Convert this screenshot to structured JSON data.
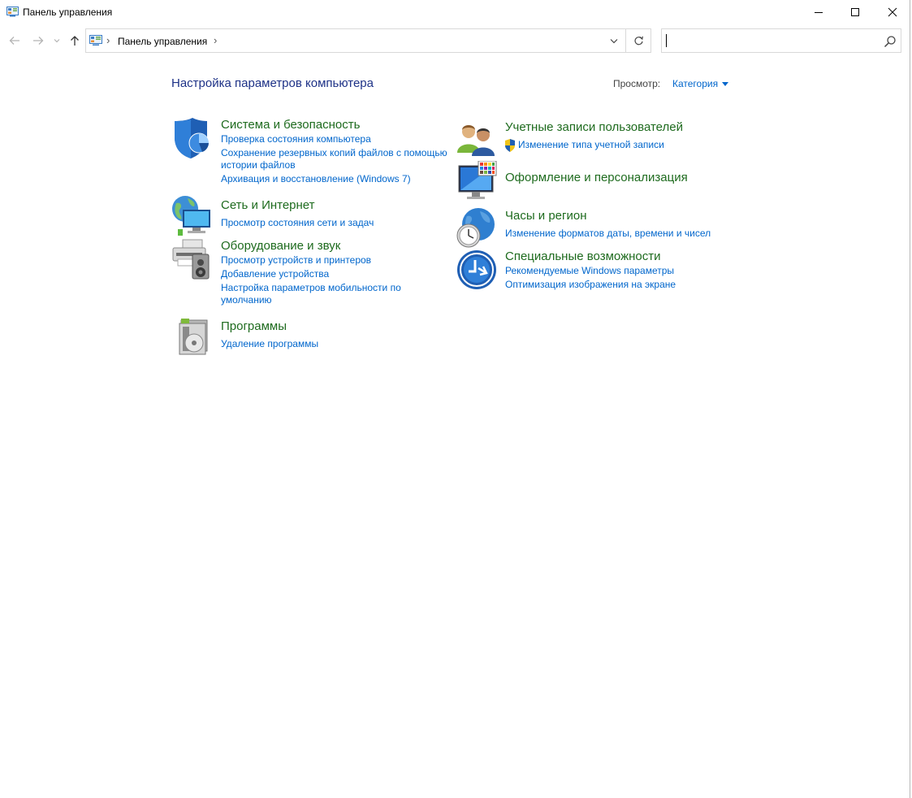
{
  "window": {
    "title": "Панель управления"
  },
  "address_bar": {
    "breadcrumb": "Панель управления"
  },
  "search": {
    "placeholder": "",
    "value": ""
  },
  "main": {
    "page_title": "Настройка параметров компьютера",
    "view_by_label": "Просмотр:",
    "view_by_value": "Категория"
  },
  "categories": {
    "system_security": {
      "title": "Система и безопасность",
      "links": [
        "Проверка состояния компьютера",
        "Сохранение резервных копий файлов с помощью истории файлов",
        "Архивация и восстановление (Windows 7)"
      ]
    },
    "network": {
      "title": "Сеть и Интернет",
      "links": [
        "Просмотр состояния сети и задач"
      ]
    },
    "hardware": {
      "title": "Оборудование и звук",
      "links": [
        "Просмотр устройств и принтеров",
        "Добавление устройства",
        "Настройка параметров мобильности по умолчанию"
      ]
    },
    "programs": {
      "title": "Программы",
      "links": [
        "Удаление программы"
      ]
    },
    "user_accounts": {
      "title": "Учетные записи пользователей",
      "links": [
        "Изменение типа учетной записи"
      ]
    },
    "appearance": {
      "title": "Оформление и персонализация",
      "links": []
    },
    "clock_region": {
      "title": "Часы и регион",
      "links": [
        "Изменение форматов даты, времени и чисел"
      ]
    },
    "accessibility": {
      "title": "Специальные возможности",
      "links": [
        "Рекомендуемые Windows параметры",
        "Оптимизация изображения на экране"
      ]
    }
  },
  "colors": {
    "category_title": "#1e6b1e",
    "link": "#0066cc",
    "page_title": "#1e3287"
  }
}
